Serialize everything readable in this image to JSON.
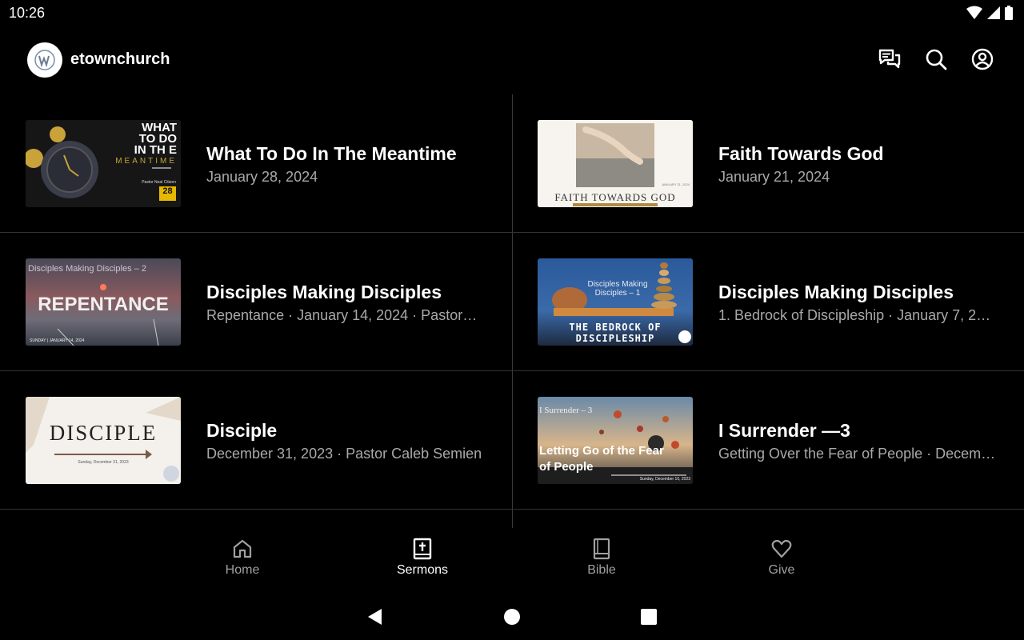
{
  "status_bar": {
    "time": "10:26",
    "icons": [
      "wifi-icon",
      "signal-icon",
      "battery-icon"
    ]
  },
  "header": {
    "app_name": "etownchurch",
    "actions": [
      "chat-icon",
      "search-icon",
      "account-icon"
    ]
  },
  "sermons": [
    {
      "title": "What To Do In The Meantime",
      "subtitle": "January 28, 2024",
      "thumb": {
        "lines": [
          "WHAT",
          "TO DO",
          "IN TH E"
        ],
        "accent": "MEANTIME",
        "pastor": "Pastor Neal Citizen",
        "badge": "28"
      }
    },
    {
      "title": "Faith Towards God",
      "subtitle": "January 21, 2024",
      "thumb": {
        "caption": "FAITH TOWARDS GOD",
        "small": "JANUARY 21, 2024"
      }
    },
    {
      "title": "Disciples Making Disciples",
      "subtitle": "Repentance · January 14, 2024 · Pastor…",
      "thumb": {
        "top": "Disciples Making Disciples – 2",
        "main": "REPENTANCE",
        "small": "SUNDAY | JANUARY 14, 2024"
      }
    },
    {
      "title": "Disciples Making Disciples",
      "subtitle": "1. Bedrock of Discipleship · January 7, 2…",
      "thumb": {
        "top": "Disciples Making Disciples – 1",
        "main1": "THE BEDROCK OF",
        "main2": "DISCIPLESHIP"
      }
    },
    {
      "title": "Disciple",
      "subtitle": "December 31, 2023 · Pastor Caleb Semien",
      "thumb": {
        "main": "DISCIPLE",
        "small": "Sunday, December 31, 2023"
      }
    },
    {
      "title": "I Surrender —3",
      "subtitle": "Getting Over the Fear of People · Decem…",
      "thumb": {
        "top": "I Surrender – 3",
        "main1": "Letting Go of the Fear",
        "main2": "of People",
        "small": "Sunday, December 10, 2023"
      }
    }
  ],
  "bottom_nav": [
    {
      "label": "Home",
      "icon": "home-icon",
      "active": false
    },
    {
      "label": "Sermons",
      "icon": "sermons-book-icon",
      "active": true
    },
    {
      "label": "Bible",
      "icon": "bible-icon",
      "active": false
    },
    {
      "label": "Give",
      "icon": "heart-icon",
      "active": false
    }
  ],
  "system_nav": [
    "back-icon",
    "home-circle-icon",
    "recents-icon"
  ],
  "colors": {
    "background": "#000000",
    "subtitle": "#a9a9a9",
    "divider": "#333333",
    "nav_inactive": "#a0a0a0"
  }
}
